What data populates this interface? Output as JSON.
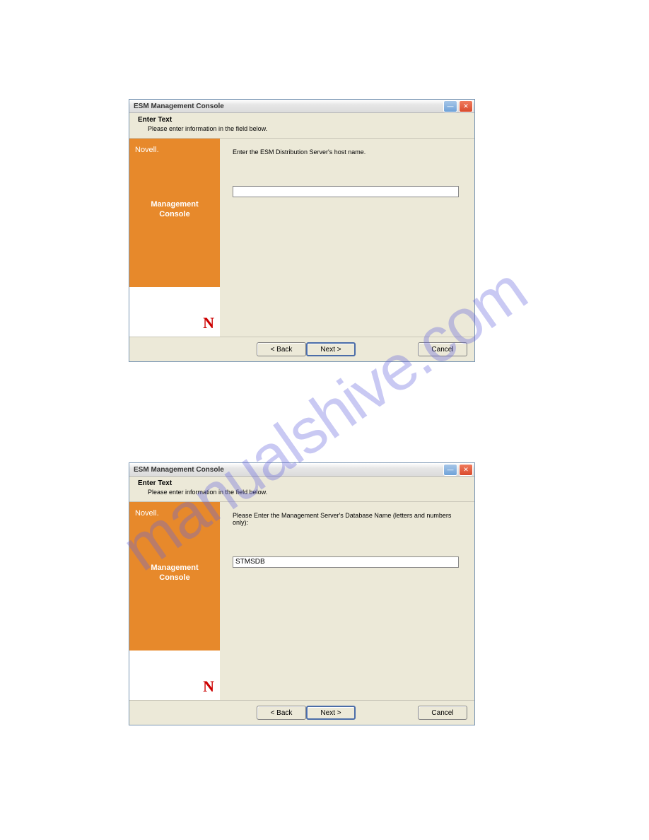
{
  "watermark": "manualshive.com",
  "dialog1": {
    "title": "ESM Management Console",
    "header_title": "Enter Text",
    "header_sub": "Please enter information in the field below.",
    "brand": "Novell.",
    "product_line1": "Management",
    "product_line2": "Console",
    "prompt": "Enter the ESM Distribution Server's host name.",
    "input_value": "",
    "back": "< Back",
    "next": "Next >",
    "cancel": "Cancel",
    "logo": "N"
  },
  "dialog2": {
    "title": "ESM Management Console",
    "header_title": "Enter Text",
    "header_sub": "Please enter information in the field below.",
    "brand": "Novell.",
    "product_line1": "Management",
    "product_line2": "Console",
    "prompt": "Please Enter the Management Server's Database Name (letters and numbers only):",
    "input_value": "STMSDB",
    "back": "< Back",
    "next": "Next >",
    "cancel": "Cancel",
    "logo": "N"
  }
}
